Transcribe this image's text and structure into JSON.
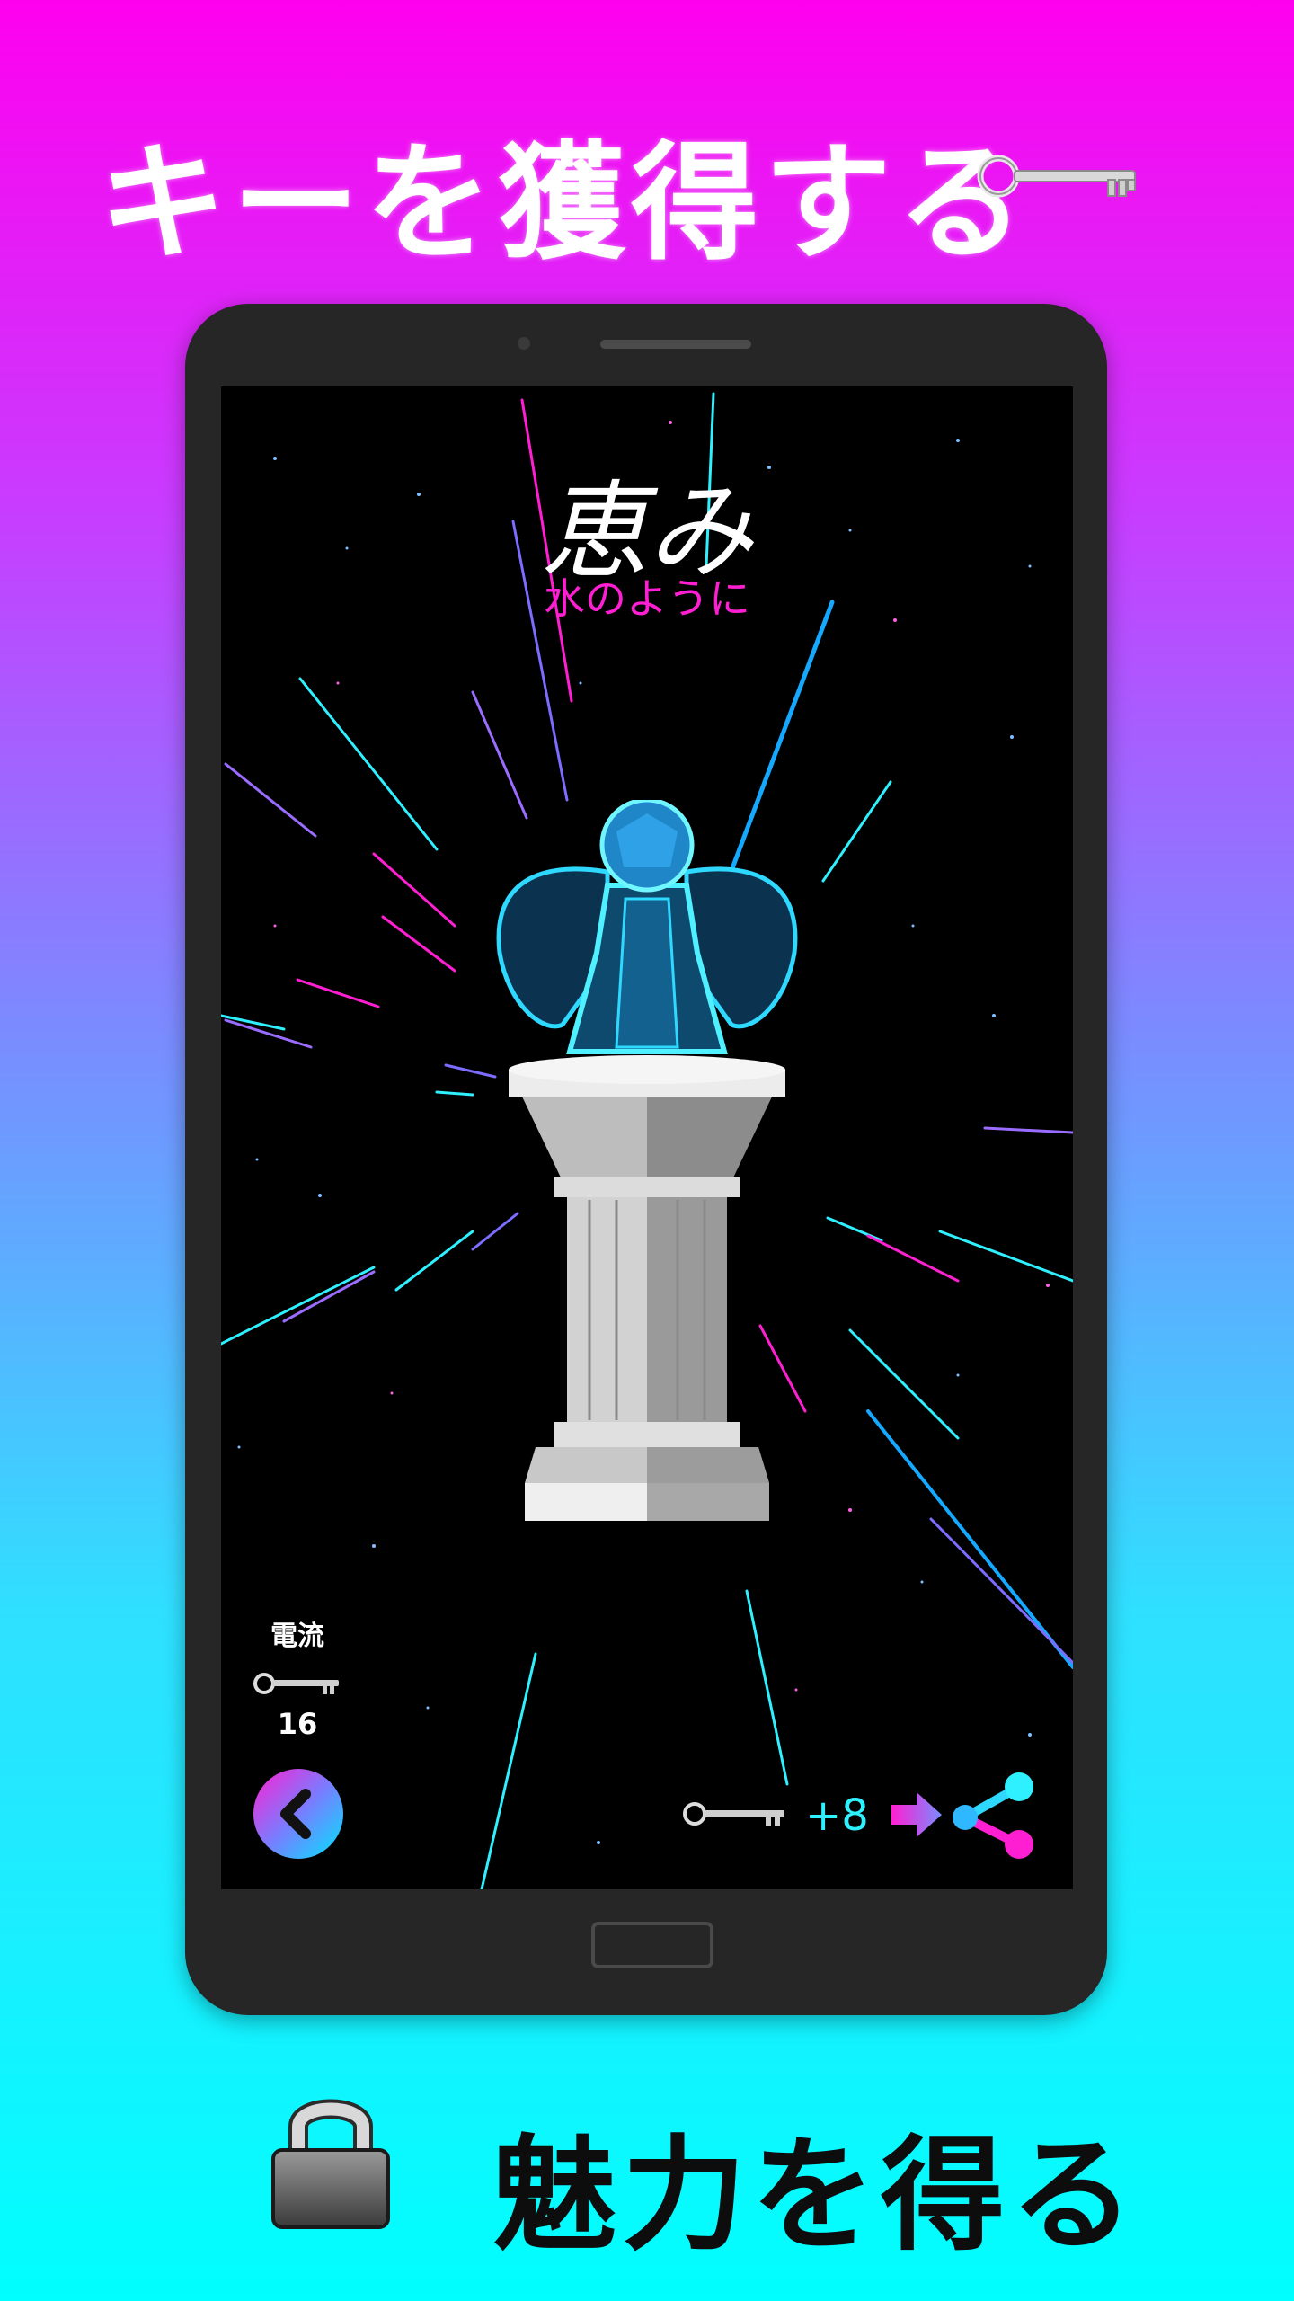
{
  "promo": {
    "top_headline": "キーを獲得する",
    "bottom_headline": "魅力を得る",
    "top_icon": "key-icon",
    "bottom_icon": "padlock-icon"
  },
  "screen": {
    "charm_title": "恵み",
    "charm_subtitle": "水のように",
    "side_panel": {
      "label": "電流",
      "key_count": "16"
    },
    "reward": {
      "amount": "+8"
    },
    "icons": {
      "back": "chevron-left-icon",
      "next": "arrow-right-icon",
      "share": "share-icon"
    }
  },
  "colors": {
    "accent_magenta": "#ff1fd2",
    "accent_cyan": "#2ff0ff",
    "phone_body": "#262626",
    "screen_bg": "#000000"
  }
}
